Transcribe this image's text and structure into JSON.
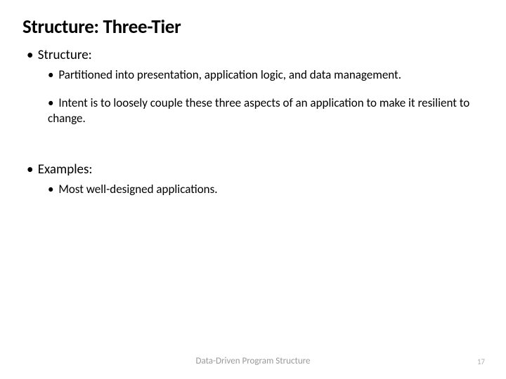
{
  "title": "Structure: Three-Tier",
  "sections": {
    "structure": {
      "heading": "Structure:",
      "items": [
        "Partitioned into presentation, application logic, and data management.",
        "Intent is to loosely couple these three aspects of an application to make it resilient to change."
      ]
    },
    "examples": {
      "heading": "Examples:",
      "items": [
        "Most well-designed applications."
      ]
    }
  },
  "footer": "Data-Driven Program Structure",
  "page_number": "17"
}
